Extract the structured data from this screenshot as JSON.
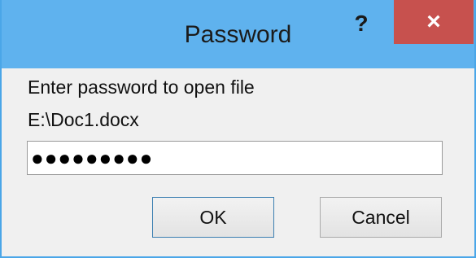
{
  "window": {
    "title": "Password",
    "help_label": "?",
    "close_label": "×"
  },
  "dialog": {
    "prompt": "Enter password to open file",
    "file_path": "E:\\Doc1.docx",
    "password_masked": "●●●●●●●●●",
    "ok_label": "OK",
    "cancel_label": "Cancel"
  },
  "colors": {
    "titlebar": "#5fb2ee",
    "close_button": "#c7514e",
    "dialog_body": "#f0f0f0"
  }
}
